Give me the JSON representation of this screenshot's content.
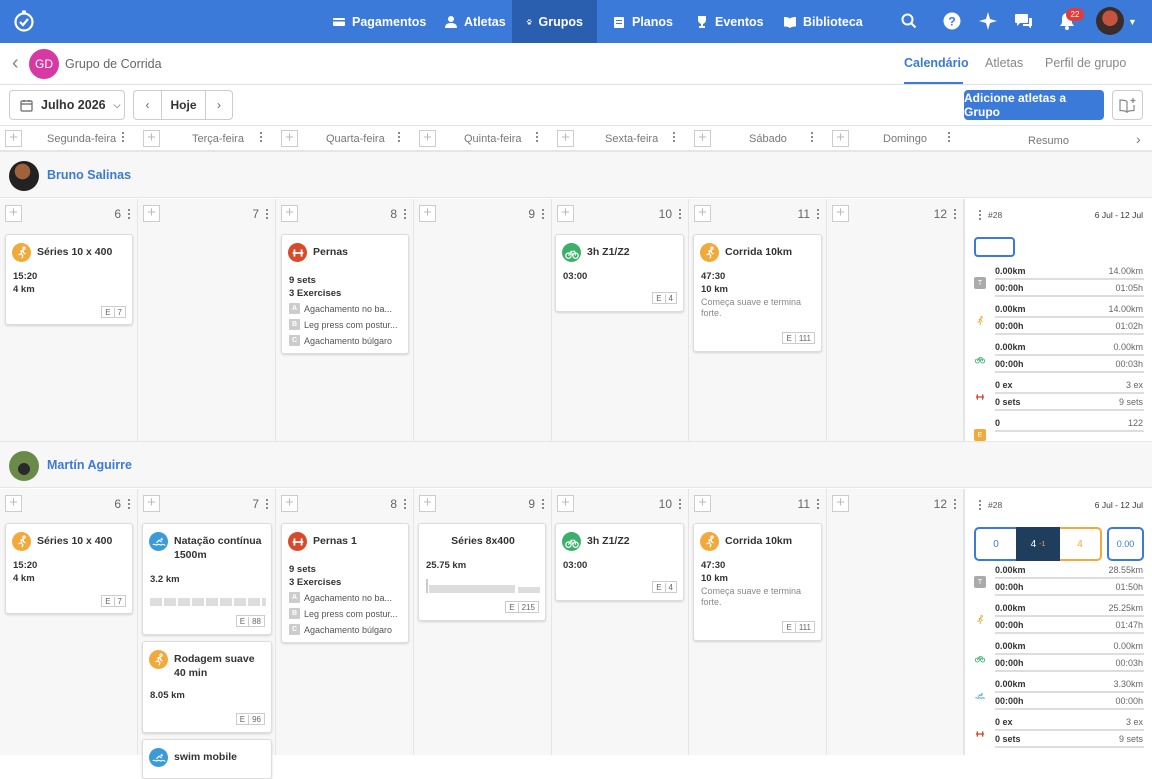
{
  "nav": {
    "items": [
      {
        "label": "Pagamentos"
      },
      {
        "label": "Atletas"
      },
      {
        "label": "Grupos"
      },
      {
        "label": "Planos"
      },
      {
        "label": "Eventos"
      },
      {
        "label": "Biblioteca"
      }
    ],
    "notifications": "22",
    "accent": "#3b7ad9"
  },
  "group": {
    "initials": "GD",
    "name": "Grupo de Corrida"
  },
  "tabs": [
    {
      "label": "Calendário"
    },
    {
      "label": "Atletas"
    },
    {
      "label": "Perfil de grupo"
    }
  ],
  "toolbar": {
    "month": "Julho 2026",
    "today": "Hoje",
    "add_athletes": "Adicione atletas a Grupo"
  },
  "days": [
    "Segunda-feira",
    "Terça-feira",
    "Quarta-feira",
    "Quinta-feira",
    "Sexta-feira",
    "Sábado",
    "Domingo"
  ],
  "summary_label": "Resumo",
  "athletes": [
    {
      "name": "Bruno Salinas",
      "daynums": [
        "6",
        "7",
        "8",
        "9",
        "10",
        "11",
        "12"
      ],
      "cards": {
        "c1": {
          "title": "Séries 10 x 400",
          "l1": "15:20",
          "l2": "4 km",
          "e": "E",
          "n": "7"
        },
        "c3": {
          "title": "Pernas",
          "l1": "9 sets",
          "l2": "3 Exercises",
          "ex": [
            {
              "k": "A",
              "t": "Agachamento no ba..."
            },
            {
              "k": "B",
              "t": "Leg press com postur..."
            },
            {
              "k": "C",
              "t": "Agachamento búlgaro"
            }
          ]
        },
        "c5": {
          "title": "3h Z1/Z2",
          "l1": "03:00",
          "e": "E",
          "n": "4"
        },
        "c6": {
          "title": "Corrida 10km",
          "l1": "47:30",
          "l2": "10 km",
          "note": "Começa suave e termina forte.",
          "e": "E",
          "n": "111"
        }
      },
      "summary": {
        "week": "#28",
        "range": "6 Jul - 12 Jul",
        "rows": [
          {
            "a": "0.00km",
            "b": "14.00km",
            "c": "00:00h",
            "d": "01:05h"
          },
          {
            "a": "0.00km",
            "b": "14.00km",
            "c": "00:00h",
            "d": "01:02h"
          },
          {
            "a": "0.00km",
            "b": "0.00km",
            "c": "00:00h",
            "d": "00:03h"
          },
          {
            "a": "0 ex",
            "b": "3 ex",
            "c": "0 sets",
            "d": "9 sets"
          },
          {
            "a": "0",
            "b": "122"
          }
        ]
      }
    },
    {
      "name": "Martín Aguirre",
      "daynums": [
        "6",
        "7",
        "8",
        "9",
        "10",
        "11",
        "12"
      ],
      "cards": {
        "c1": {
          "title": "Séries 10 x 400",
          "l1": "15:20",
          "l2": "4 km",
          "e": "E",
          "n": "7"
        },
        "c2": {
          "title": "Natação contínua 1500m",
          "l1": "3.2 km",
          "e": "E",
          "n": "88"
        },
        "c2b": {
          "title": "Rodagem suave 40 min",
          "l1": "8.05 km",
          "e": "E",
          "n": "96"
        },
        "c2c": {
          "title": "swim mobile"
        },
        "c3": {
          "title": "Pernas 1",
          "l1": "9 sets",
          "l2": "3 Exercises",
          "ex": [
            {
              "k": "A",
              "t": "Agachamento no ba..."
            },
            {
              "k": "B",
              "t": "Leg press com postur..."
            },
            {
              "k": "C",
              "t": "Agachamento búlgaro"
            }
          ]
        },
        "c4": {
          "title": "Séries 8x400",
          "l1": "25.75 km",
          "e": "E",
          "n": "215"
        },
        "c5": {
          "title": "3h Z1/Z2",
          "l1": "03:00",
          "e": "E",
          "n": "4"
        },
        "c6": {
          "title": "Corrida 10km",
          "l1": "47:30",
          "l2": "10 km",
          "note": "Começa suave e termina forte.",
          "e": "E",
          "n": "111"
        }
      },
      "summary": {
        "week": "#28",
        "range": "6 Jul - 12 Jul",
        "boxes": {
          "a": "0",
          "b": "4",
          "b2": "-1",
          "c": "4",
          "d": "0.00"
        },
        "rows": [
          {
            "a": "0.00km",
            "b": "28.55km",
            "c": "00:00h",
            "d": "01:50h"
          },
          {
            "a": "0.00km",
            "b": "25.25km",
            "c": "00:00h",
            "d": "01:47h"
          },
          {
            "a": "0.00km",
            "b": "0.00km",
            "c": "00:00h",
            "d": "00:03h"
          },
          {
            "a": "0.00km",
            "b": "3.30km",
            "c": "00:00h",
            "d": "00:00h"
          },
          {
            "a": "0 ex",
            "b": "3 ex",
            "c": "0 sets",
            "d": "9 sets"
          }
        ]
      }
    }
  ]
}
